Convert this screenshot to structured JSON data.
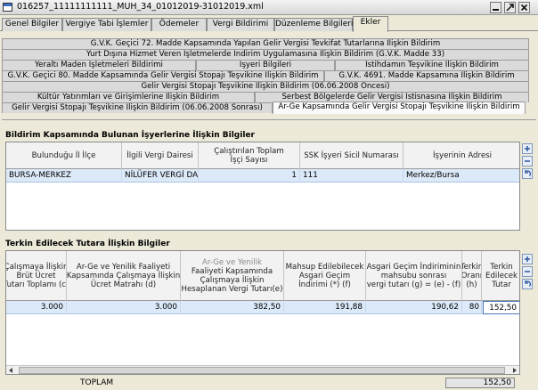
{
  "window": {
    "title": "016257_11111111111_MUH_34_01012019-31012019.xml"
  },
  "main_tabs": [
    {
      "label": "Genel Bilgiler"
    },
    {
      "label": "Vergiye Tabi İşlemler"
    },
    {
      "label": "Ödemeler"
    },
    {
      "label": "Vergi Bildirimi"
    },
    {
      "label": "Düzenleme Bilgileri"
    },
    {
      "label": "Ekler"
    }
  ],
  "sub_tabs": [
    {
      "label": "G.V.K. Geçici 72. Madde Kapsamında Yapılan Gelir Vergisi Tevkifat Tutarlarına İlişkin Bildirim"
    },
    {
      "label": "Yurt Dışına Hizmet Veren İşletmelerde İndirim Uygulamasına İlişkin Bildirim (G.V.K. Madde 33)"
    },
    {
      "label": "Yeraltı Maden İşletmeleri Bildirimi"
    },
    {
      "label": "İşyeri Bilgileri"
    },
    {
      "label": "İstihdamın Teşvikine İlişkin Bildirim"
    },
    {
      "label": "G.V.K. Geçici 80. Madde Kapsamında Gelir Vergisi Stopajı Teşvikine İlişkin Bildirim"
    },
    {
      "label": "G.V.K. 4691. Madde Kapsamına İlişkin Bildirim"
    },
    {
      "label": "Gelir Vergisi Stopajı Teşvikine İlişkin Bildirim (06.06.2008 Öncesi)"
    },
    {
      "label": "Kültür Yatırımları ve Girişimlerine İlişkin Bildirim"
    },
    {
      "label": "Serbest Bölgelerde Gelir Vergisi İstisnasına İlişkin Bildirim"
    },
    {
      "label": "Gelir Vergisi Stopajı Teşvikine İlişkin Bildirim (06.06.2008 Sonrası)"
    },
    {
      "label": "Ar-Ge Kapsamında Gelir Vergisi Stopajı Teşvikine İlişkin Bildirim"
    }
  ],
  "workplaces": {
    "title": "Bildirim Kapsamında Bulunan İşyerlerine İlişkin Bilgiler",
    "columns": [
      {
        "l1": "Bulunduğu İl İlçe",
        "l2": ""
      },
      {
        "l1": "İlgili Vergi Dairesi",
        "l2": ""
      },
      {
        "l1": "Çalıştırılan Toplam",
        "l2": "İşçi Sayısı"
      },
      {
        "l1": "SSK İşyeri Sicil Numarası",
        "l2": ""
      },
      {
        "l1": "İşyerinin Adresi",
        "l2": ""
      }
    ],
    "rows": [
      [
        "BURSA-MERKEZ",
        "NİLÜFER VERGİ DAİ...",
        "1",
        "111",
        "Merkez/Bursa"
      ]
    ]
  },
  "deduction": {
    "title": "Terkin Edilecek Tutara İlişkin Bilgiler",
    "columns": [
      {
        "l1": "Çalışmaya İlişkin",
        "l2": "Brüt Ücret",
        "l3": "Tutarı Toplamı (c)"
      },
      {
        "l1": "Ar-Ge ve Yenilik Faaliyeti",
        "l2": "Kapsamında Çalışmaya İlişkin",
        "l3": "Ücret Matrahı (d)"
      },
      {
        "l1": "Ar-Ge ve Yenilik",
        "l2": "Faaliyeti Kapsamında",
        "l3": "Çalışmaya İlişkin",
        "l4": "Hesaplanan Vergi Tutarı(e)"
      },
      {
        "l1": "Mahsup Edilebilecek",
        "l2": "Asgari Geçim",
        "l3": "İndirimi (*) (f)"
      },
      {
        "l1": "Asgari Geçim İndiriminin",
        "l2": "mahsubu sonrası",
        "l3": "vergi tutarı (g) = (e) - (f)"
      },
      {
        "l1": "Terkin",
        "l2": "Oranı",
        "l3": "(h)"
      },
      {
        "l1": "Terkin",
        "l2": "Edilecek",
        "l3": "Tutar"
      }
    ],
    "rows": [
      [
        "3.000",
        "3.000",
        "382,50",
        "191,88",
        "190,62",
        "80",
        "152,50"
      ]
    ]
  },
  "footer": {
    "total_label": "TOPLAM",
    "total_value": "152,50"
  }
}
